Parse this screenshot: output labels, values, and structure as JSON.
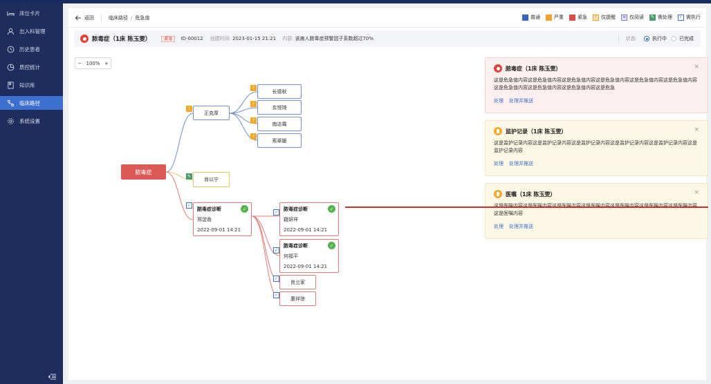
{
  "sidebar": {
    "items": [
      {
        "label": "床位卡片",
        "icon": "bed-icon"
      },
      {
        "label": "出入科管理",
        "icon": "user-icon"
      },
      {
        "label": "历史患者",
        "icon": "history-icon"
      },
      {
        "label": "质控统计",
        "icon": "pie-chart-icon"
      },
      {
        "label": "知识库",
        "icon": "book-icon"
      },
      {
        "label": "临床路径",
        "icon": "path-icon",
        "active": true
      },
      {
        "label": "系统设置",
        "icon": "gear-icon"
      }
    ]
  },
  "toolbar": {
    "back_label": "返回",
    "breadcrumb": [
      "临床路径",
      "危急值"
    ],
    "breadcrumb_sep": "/"
  },
  "legend": {
    "normal": "普通",
    "severe": "严重",
    "urgent": "紧急",
    "remind_only": "仅提醒",
    "read_only": "仅阅读",
    "need_handle": "需处理",
    "need_exec": "需执行",
    "colors": {
      "normal": "#3a64c0",
      "severe": "#f0a32a",
      "urgent": "#dc4d47"
    }
  },
  "info": {
    "title": "脓毒症（1床 陈玉雯）",
    "tag": "紧急",
    "id": "ID-00012",
    "created_label": "创建时间:",
    "created_value": "2023-01-15 21:21",
    "content_label": "内容:",
    "content_value": "该病人脓毒症预警因子系数超过70%",
    "status_label": "状态:",
    "status_running": "执行中",
    "status_done": "已完成"
  },
  "zoom": {
    "minus": "−",
    "value": "100%",
    "plus": "+"
  },
  "map": {
    "root": "脓毒症",
    "branch1": "正克厚",
    "leaves1": [
      "长德秋",
      "玄悦琦",
      "南达骞",
      "索翠媛"
    ],
    "branch2": "肖以宁",
    "diag_main": {
      "title": "脓毒症诊断",
      "name": "郑淀香",
      "date": "2022-09-01 14:21"
    },
    "diag_a": {
      "title": "脓毒症诊断",
      "name": "籍妍祥",
      "date": "2022-09-01 14:21"
    },
    "diag_b": {
      "title": "脓毒症诊断",
      "name": "何福平",
      "date": "2022-09-01 14:21"
    },
    "small1": "良兰家",
    "small2": "惠祥琼"
  },
  "notices": [
    {
      "title": "脓毒症（1床 陈玉雯）",
      "body": "这是危急值内容这是危急值内容这是危急值内容这是危急值内容这是危急值内容这是危急值内容这是危急值内容这是危急值内容这是危急值内容这是危急",
      "act1": "处理",
      "act2": "处理并推送"
    },
    {
      "title": "监护记录（1床 陈玉雯）",
      "body": "这是监护记录内容这是监护记录内容这是监护记录内容这是监护记录内容这是监护记录内容这是监护记录内容",
      "act1": "处理",
      "act2": "处理并推送"
    },
    {
      "title": "医嘱（1床 陈玉雯）",
      "body": "这是医嘱内容这是医嘱内容这是医嘱内容这是医嘱内容这是医嘱内容这是医嘱内容这是医嘱内容这是医嘱内容",
      "act1": "处理",
      "act2": "处理并推送"
    }
  ]
}
